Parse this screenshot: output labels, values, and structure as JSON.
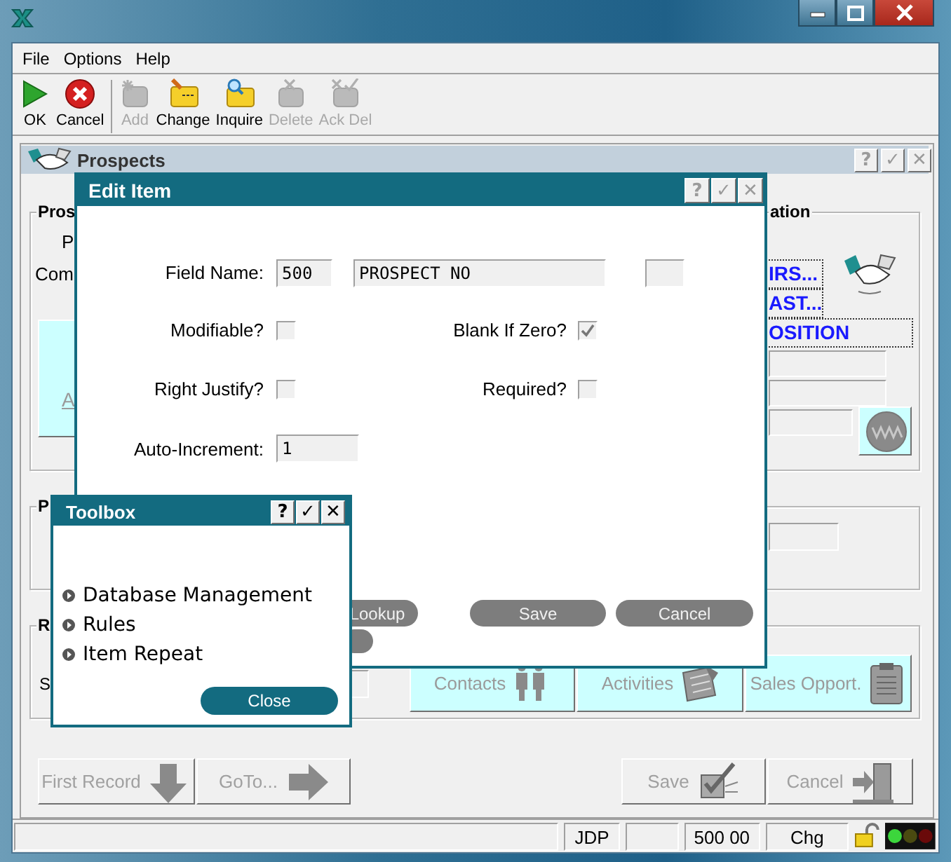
{
  "menu": [
    {
      "label": "File"
    },
    {
      "label": "Options"
    },
    {
      "label": "Help"
    }
  ],
  "toolbar": [
    {
      "label": "OK",
      "kind": "ok",
      "disabled": false
    },
    {
      "label": "Cancel",
      "kind": "cancel",
      "disabled": false
    },
    {
      "label": "Add",
      "kind": "add",
      "disabled": true
    },
    {
      "label": "Change",
      "kind": "change",
      "disabled": false
    },
    {
      "label": "Inquire",
      "kind": "inquire",
      "disabled": false
    },
    {
      "label": "Delete",
      "kind": "delete",
      "disabled": true
    },
    {
      "label": "Ack Del",
      "kind": "ackdel",
      "disabled": true
    }
  ],
  "prospects": {
    "title": "Prospects",
    "title_buttons": [
      {
        "text": "?",
        "disabled": true
      },
      {
        "text": "✓",
        "disabled": true
      },
      {
        "text": "✕",
        "disabled": true
      }
    ],
    "identity_group": {
      "title": "Pros",
      "labels": [
        "P",
        "Com"
      ],
      "link": "A"
    },
    "contact_group": {
      "title": "ation",
      "links": [
        "IRS...",
        "AST...",
        "OSITION"
      ]
    },
    "p_group": {
      "title": "P"
    },
    "r_group": {
      "title": "R",
      "label": "S",
      "buttons": [
        {
          "label": "Contacts",
          "kind": "contacts"
        },
        {
          "label": "Activities",
          "kind": "activities"
        },
        {
          "label": "Sales Opport.",
          "kind": "sales"
        }
      ]
    },
    "nav_buttons": [
      {
        "label": "First Record",
        "kind": "down"
      },
      {
        "label": "GoTo...",
        "kind": "right"
      }
    ],
    "action_buttons": [
      {
        "label": "Save",
        "kind": "save"
      },
      {
        "label": "Cancel",
        "kind": "exit"
      }
    ]
  },
  "edit_item": {
    "title": "Edit Item",
    "title_buttons": [
      {
        "text": "?",
        "disabled": true
      },
      {
        "text": "✓",
        "disabled": true
      },
      {
        "text": "✕",
        "disabled": true
      }
    ],
    "field_name": {
      "label": "Field Name:",
      "number": "500",
      "name": "PROSPECT NO"
    },
    "checks": [
      {
        "label": "Modifiable?",
        "checked": false
      },
      {
        "label": "Blank If Zero?",
        "checked": true
      },
      {
        "label": "Right Justify?",
        "checked": false
      },
      {
        "label": "Required?",
        "checked": false
      }
    ],
    "auto_increment": {
      "label": "Auto-Increment:",
      "value": "1"
    },
    "lookup": "Lookup",
    "buttons": [
      {
        "label": "Save"
      },
      {
        "label": "Cancel"
      }
    ]
  },
  "toolbox": {
    "title": "Toolbox",
    "title_buttons": [
      {
        "text": "?",
        "disabled": false
      },
      {
        "text": "✓",
        "disabled": false
      },
      {
        "text": "✕",
        "disabled": false
      }
    ],
    "items": [
      {
        "label": "Database Management"
      },
      {
        "label": "Rules"
      },
      {
        "label": "Item Repeat"
      }
    ],
    "close": "Close"
  },
  "status_bar": {
    "fields": [
      {
        "kind": "blank"
      },
      {
        "kind": "text",
        "text": "JDP"
      },
      {
        "kind": "blank"
      },
      {
        "kind": "text",
        "text": "500 00"
      },
      {
        "kind": "text",
        "text": "Chg"
      }
    ]
  }
}
